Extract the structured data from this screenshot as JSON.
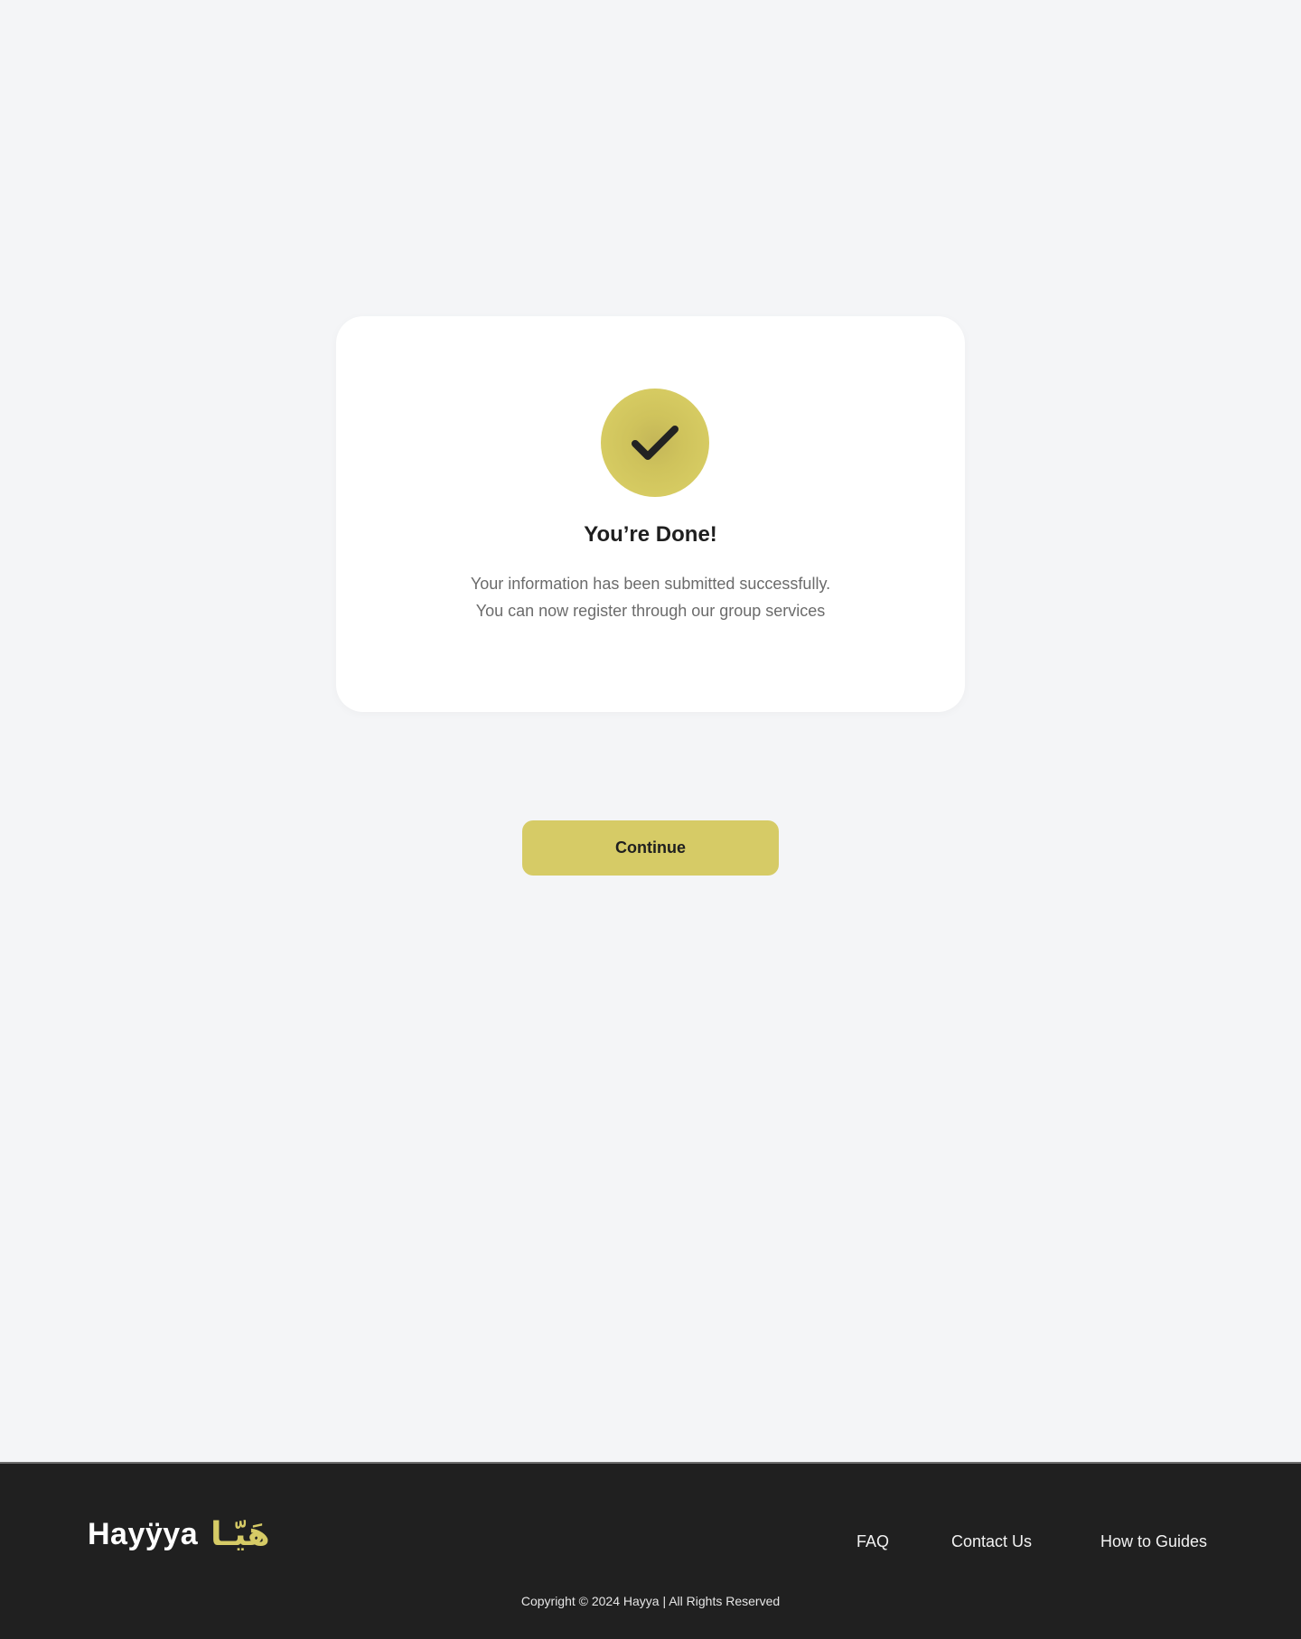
{
  "success_card": {
    "icon": "check-icon",
    "title": "You’re Done!",
    "message_line1": "Your information has been submitted successfully.",
    "message_line2": "You can now register through our group services"
  },
  "actions": {
    "continue_label": "Continue"
  },
  "footer": {
    "logo_text": "Hayÿya",
    "logo_arabic": "هَيّـا",
    "links": [
      "FAQ",
      "Contact Us",
      "How to Guides"
    ],
    "copyright": "Copyright © 2024 Hayya | All Rights Reserved"
  },
  "colors": {
    "accent": "#d6cb66",
    "background": "#f4f5f7",
    "card": "#ffffff",
    "footer": "#202020",
    "text_dark": "#1f1f1f",
    "text_muted": "#6b6b6b"
  }
}
